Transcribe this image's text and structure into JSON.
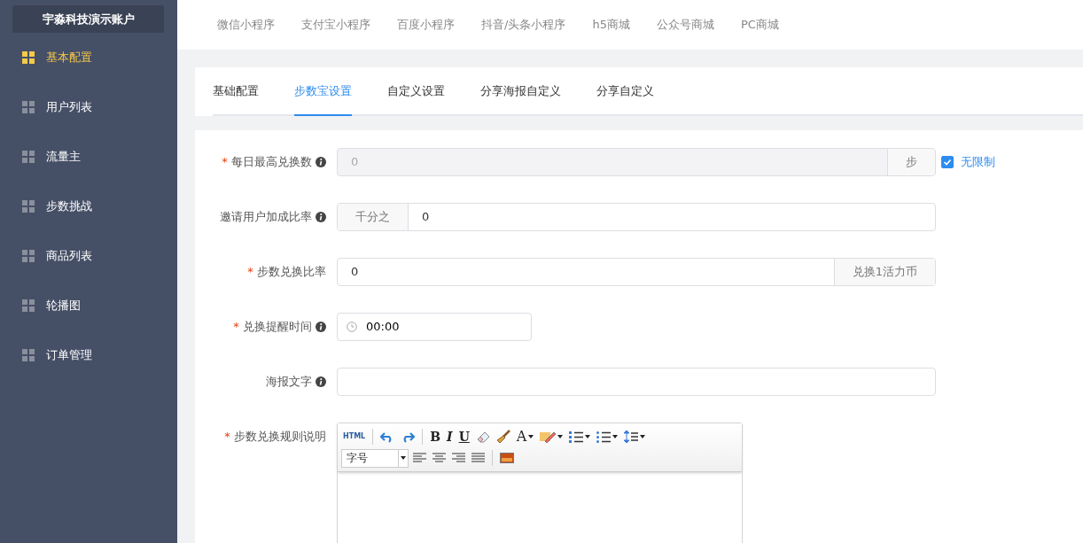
{
  "sidebar": {
    "account": "宇淼科技演示账户",
    "items": [
      {
        "label": "基本配置",
        "selected": true
      },
      {
        "label": "用户列表",
        "selected": false
      },
      {
        "label": "流量主",
        "selected": false
      },
      {
        "label": "步数挑战",
        "selected": false
      },
      {
        "label": "商品列表",
        "selected": false
      },
      {
        "label": "轮播图",
        "selected": false
      },
      {
        "label": "订单管理",
        "selected": false
      }
    ]
  },
  "top_tabs": [
    {
      "label": "微信小程序",
      "selected": false
    },
    {
      "label": "支付宝小程序",
      "selected": false
    },
    {
      "label": "百度小程序",
      "selected": false
    },
    {
      "label": "抖音/头条小程序",
      "selected": false
    },
    {
      "label": "h5商城",
      "selected": false
    },
    {
      "label": "公众号商城",
      "selected": false
    },
    {
      "label": "PC商城",
      "selected": false
    }
  ],
  "sub_tabs": [
    {
      "label": "基础配置",
      "selected": false
    },
    {
      "label": "步数宝设置",
      "selected": true
    },
    {
      "label": "自定义设置",
      "selected": false
    },
    {
      "label": "分享海报自定义",
      "selected": false
    },
    {
      "label": "分享自定义",
      "selected": false
    }
  ],
  "form": {
    "fields": [
      {
        "kind": "append",
        "mark": "*",
        "label": "每日最高兑换数",
        "help": true,
        "value": "0",
        "addon": "步",
        "disabled": true,
        "checkbox": {
          "label": "无限制",
          "checked": true
        }
      },
      {
        "kind": "prepend",
        "label": "邀请用户加成比率",
        "help": true,
        "addon": "千分之",
        "value": "0",
        "disabled": false
      },
      {
        "kind": "append",
        "mark": "*",
        "label": "步数兑换比率",
        "help": false,
        "value": "0",
        "addon": "兑换1活力币",
        "disabled": false
      },
      {
        "kind": "time",
        "mark": "*",
        "label": "兑换提醒时间",
        "help": true,
        "value": "00:00"
      },
      {
        "kind": "input",
        "label": "海报文字",
        "help": true
      },
      {
        "kind": "editor",
        "mark": "*",
        "label": "步数兑换规则说明",
        "help": false,
        "toolbar": [
          [
            {
              "kind": "html",
              "label": "HTML"
            },
            {
              "kind": "sep"
            },
            {
              "kind": "undo"
            },
            {
              "kind": "redo"
            },
            {
              "kind": "sep"
            },
            {
              "kind": "bold",
              "label": "B"
            },
            {
              "kind": "italic",
              "label": "I"
            },
            {
              "kind": "underline",
              "label": "U"
            },
            {
              "kind": "eraser"
            },
            {
              "kind": "brush"
            },
            {
              "kind": "fontcolor",
              "label": "A",
              "dropdown": true
            },
            {
              "kind": "highlight",
              "dropdown": true
            },
            {
              "kind": "ol",
              "dropdown": true
            },
            {
              "kind": "ul",
              "dropdown": true
            },
            {
              "kind": "lineheight",
              "dropdown": true
            }
          ],
          [
            {
              "kind": "select",
              "label": "字号"
            },
            {
              "kind": "left"
            },
            {
              "kind": "center"
            },
            {
              "kind": "right"
            },
            {
              "kind": "justify"
            },
            {
              "kind": "sep"
            },
            {
              "kind": "image"
            }
          ]
        ]
      }
    ]
  }
}
